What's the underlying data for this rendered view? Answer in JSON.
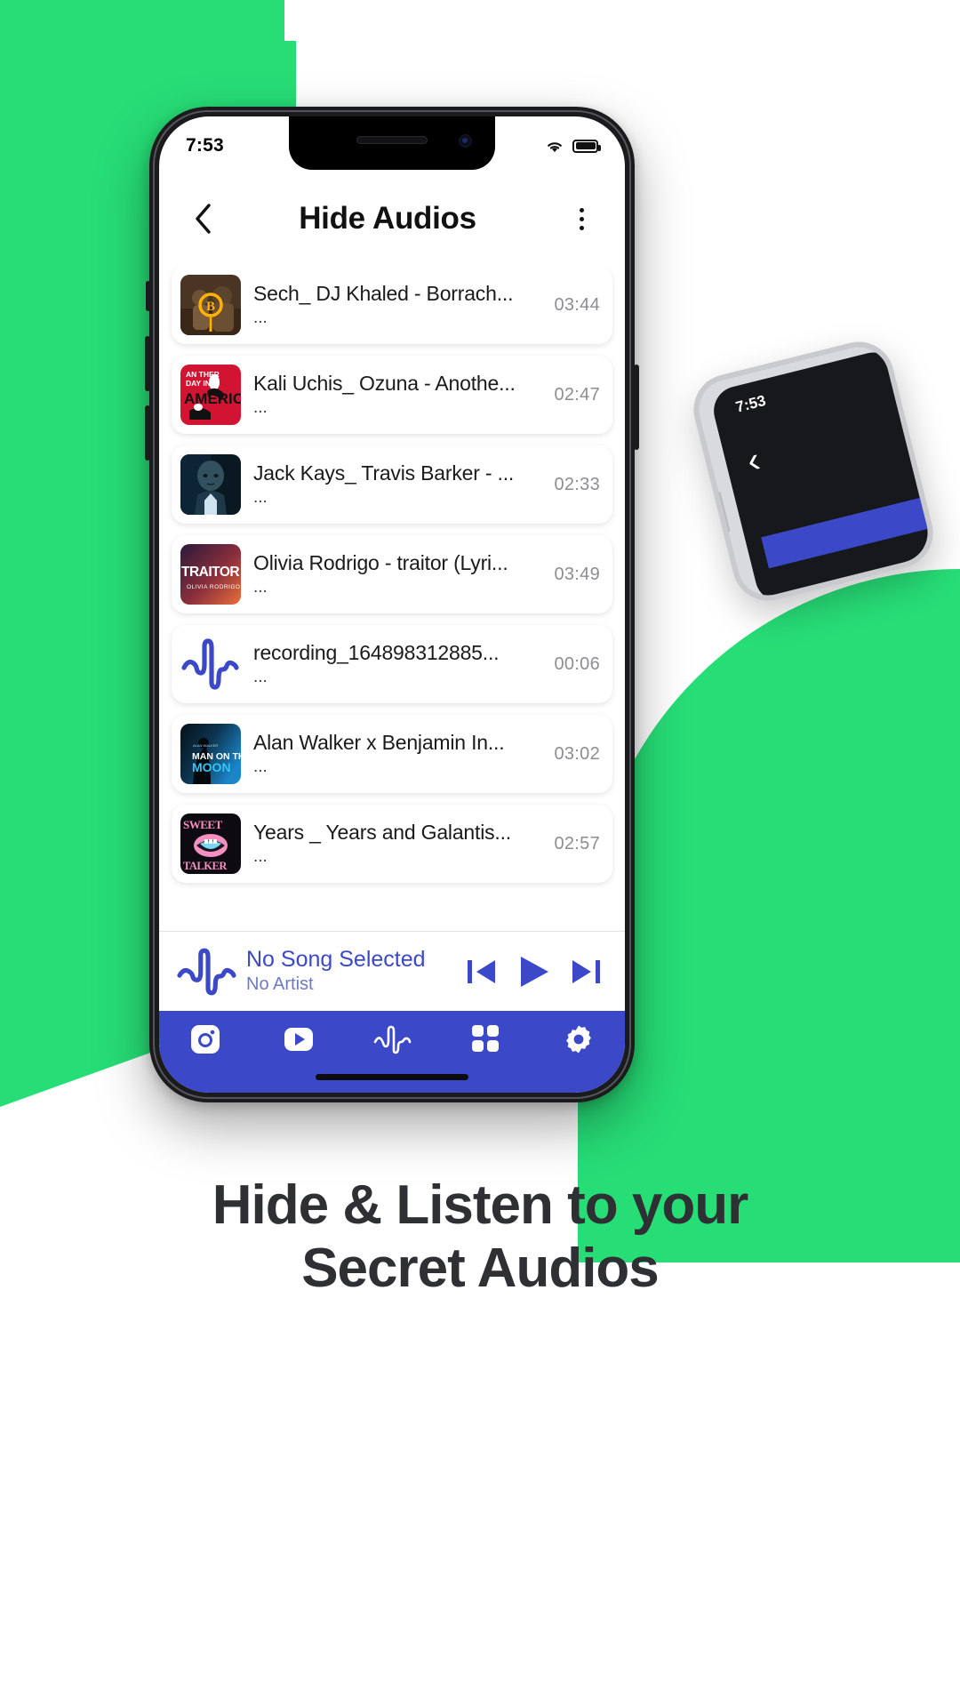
{
  "background": {
    "accent_green": "#27dd76",
    "accent_indigo": "#3b49c9"
  },
  "phone_secondary": {
    "time": "7:53",
    "back_icon": "chevron-left-icon"
  },
  "status_bar": {
    "time": "7:53",
    "wifi_icon": "wifi-icon",
    "battery_icon": "battery-icon",
    "battery_level": "full"
  },
  "header": {
    "back_icon": "chevron-left-icon",
    "title": "Hide Audios",
    "menu_icon": "overflow-menu-icon"
  },
  "audio_list": [
    {
      "title": "Sech_ DJ Khaled - Borrach...",
      "subtitle": "...",
      "duration": "03:44",
      "artwork": "borracho-cover"
    },
    {
      "title": "Kali Uchis_ Ozuna - Anothe...",
      "subtitle": "...",
      "duration": "02:47",
      "artwork": "another-day-in-america-cover"
    },
    {
      "title": "Jack Kays_ Travis Barker - ...",
      "subtitle": "...",
      "duration": "02:33",
      "artwork": "jack-kays-cover"
    },
    {
      "title": "Olivia Rodrigo - traitor (Lyri...",
      "subtitle": "...",
      "duration": "03:49",
      "artwork": "traitor-cover"
    },
    {
      "title": "recording_164898312885...",
      "subtitle": "...",
      "duration": "00:06",
      "artwork": "audio-wave-icon"
    },
    {
      "title": "Alan Walker x Benjamin In...",
      "subtitle": "...",
      "duration": "03:02",
      "artwork": "man-on-the-moon-cover"
    },
    {
      "title": "Years _ Years and Galantis...",
      "subtitle": "...",
      "duration": "02:57",
      "artwork": "sweet-talker-cover"
    }
  ],
  "now_playing": {
    "wave_icon": "audio-wave-icon",
    "title": "No Song Selected",
    "artist": "No Artist",
    "prev_icon": "skip-previous-icon",
    "play_icon": "play-icon",
    "next_icon": "skip-next-icon"
  },
  "bottom_nav": {
    "items": [
      {
        "icon": "photos-icon",
        "active": false
      },
      {
        "icon": "videos-icon",
        "active": false
      },
      {
        "icon": "audios-icon",
        "active": true
      },
      {
        "icon": "grid-apps-icon",
        "active": false
      },
      {
        "icon": "settings-gear-icon",
        "active": false
      }
    ]
  },
  "caption": {
    "line1": "Hide & Listen to your",
    "line2": "Secret Audios"
  }
}
